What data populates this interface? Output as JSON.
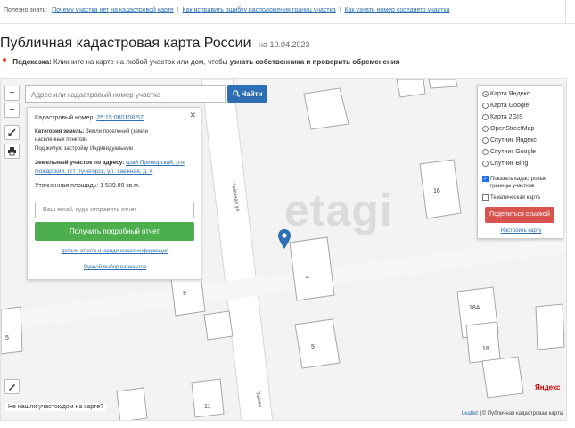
{
  "topbar": {
    "label": "Полезно знать:",
    "links": [
      "Почему участка нет на кадастровой карте",
      "Как исправить ошибку расположения границ участка",
      "Как узнать номер соседнего участка"
    ]
  },
  "page": {
    "title": "Публичная кадастровая карта России",
    "date": "на 10.04.2023"
  },
  "hint": {
    "label": "Подсказка:",
    "text": "Кликните на карте на любой участок или дом, чтобы",
    "bold": "узнать собственника и проверить обременения"
  },
  "search": {
    "placeholder": "Адрес или кадастровый номер участка",
    "button": "Найти"
  },
  "controls": {
    "zoom_in": "+",
    "zoom_out": "−"
  },
  "info": {
    "cad_label": "Кадастровый номер:",
    "cad_number": "25:15:080108:57",
    "category_label": "Категория земель:",
    "category_value": "Земли поселений (земли",
    "category_value2": "населенных пунктов)",
    "use": "Под жилую застройку Индивидуальную",
    "address_label": "Земельный участок по адресу:",
    "address_value": "край Приморский, р-н",
    "address_value2": "Пожарский, пгт Лучегорск, ул. Таежная, д. 4",
    "area_label": "Уточненная площадь:",
    "area_value": "1 539.00 кв.м.",
    "email_placeholder": "Ваш email, куда отправить отчет",
    "report_button": "Получить подробный отчет",
    "link_details": "детали отчета и юридическая информация",
    "link_manual": "Ручной выбор вариантов"
  },
  "layers": {
    "options": [
      {
        "label": "Карта Яндекс",
        "selected": true
      },
      {
        "label": "Карта Google",
        "selected": false
      },
      {
        "label": "Карта 2GIS",
        "selected": false
      },
      {
        "label": "OpenStreetMap",
        "selected": false
      },
      {
        "label": "Спутник Яндекс",
        "selected": false
      },
      {
        "label": "Спутник Google",
        "selected": false
      },
      {
        "label": "Спутник Bing",
        "selected": false
      }
    ],
    "show_borders_1": "Показать кадастровые",
    "show_borders_2": "границы участков",
    "thematic": "Тематическая карта",
    "share_button": "Поделиться ссылкой",
    "configure": "Настроить карту"
  },
  "map": {
    "watermark": "etagi",
    "streets": [
      "Таёжная ул.",
      "Таёжн"
    ],
    "house_numbers": [
      "16",
      "4",
      "9",
      "5",
      "18А",
      "18",
      "11",
      "5"
    ],
    "bottom_note": "Не нашли участок/дом на карте?",
    "yandex": "Яндекс",
    "copyright_link": "Leaflet",
    "copyright": "| © Публичная кадастровая карта"
  },
  "colors": {
    "search_button": "#2e6eb5",
    "report_button": "#4cae4c",
    "share_button": "#d9534f",
    "marker": "#2d6fb5"
  }
}
